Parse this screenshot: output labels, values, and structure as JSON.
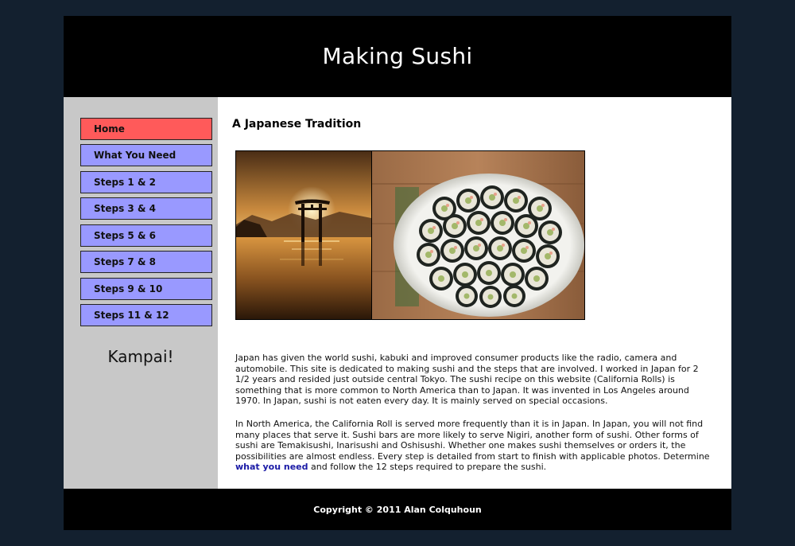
{
  "header": {
    "title": "Making Sushi"
  },
  "nav": {
    "items": [
      {
        "label": "Home",
        "active": true
      },
      {
        "label": "What You Need"
      },
      {
        "label": "Steps 1 & 2"
      },
      {
        "label": "Steps 3 & 4"
      },
      {
        "label": "Steps 5 & 6"
      },
      {
        "label": "Steps 7 & 8"
      },
      {
        "label": "Steps 9 & 10"
      },
      {
        "label": "Steps 11 & 12"
      }
    ],
    "tagline": "Kampai!"
  },
  "main": {
    "heading": "A Japanese Tradition",
    "paragraph1": "Japan has given the world sushi, kabuki and improved consumer products like the radio, camera and automobile. This site is dedicated to making sushi and the steps that are involved. I worked in Japan for 2 1/2 years and resided just outside central Tokyo. The sushi recipe on this website (California Rolls) is something that is more common to North America than to Japan. It was invented in Los Angeles around 1970. In Japan, sushi is not eaten every day. It is mainly served on special occasions.",
    "paragraph2_before": "In North America, the California Roll is served more frequently than it is in Japan. In Japan, you will not find many places that serve it. Sushi bars are more likely to serve Nigiri, another form of sushi. Other forms of sushi are Temakisushi, Inarisushi and Oshisushi. Whether one makes sushi themselves or orders it, the possibilities are almost endless. Every step is detailed from start to finish with applicable photos. Determine ",
    "paragraph2_link": "what you need",
    "paragraph2_after": " and follow the 12 steps required to prepare the sushi."
  },
  "footer": {
    "copyright": "Copyright © 2011 Alan Colquhoun"
  },
  "colors": {
    "background": "#13202f",
    "nav_active": "#ff5a5a",
    "nav_inactive": "#9999ff",
    "sidebar": "#c8c8c8",
    "link": "#1a1aa6"
  }
}
